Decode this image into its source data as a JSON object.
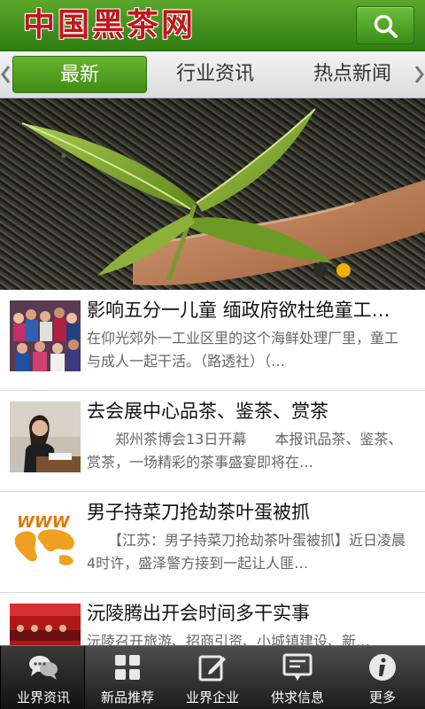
{
  "header": {
    "logo_text": "中国黑茶网",
    "search_icon": "search-icon"
  },
  "tabs": [
    {
      "label": "最新",
      "active": true
    },
    {
      "label": "行业资讯",
      "active": false
    },
    {
      "label": "热点新闻",
      "active": false
    }
  ],
  "banner": {
    "image": "tea-leaves-on-wooden-spoon",
    "slide_count": 2,
    "active_slide": 2
  },
  "news": [
    {
      "title": "影响五分一儿童 缅政府欲杜绝童工…",
      "desc": "在仰光郊外一工业区里的这个海鲜处理厂里，童工与成人一起干活。（路透社）（…"
    },
    {
      "title": "去会展中心品茶、鉴茶、赏茶",
      "desc": "　　郑州茶博会13日开幕　　本报讯品茶、鉴茶、赏茶，一场精彩的茶事盛宴即将在…"
    },
    {
      "title": "男子持菜刀抢劫茶叶蛋被抓",
      "desc": "　　【江苏：男子持菜刀抢劫茶叶蛋被抓】近日凌晨4时许，盛泽警方接到一起让人匪…"
    },
    {
      "title": "沅陵腾出开会时间多干实事",
      "desc": "沅陵召开旅游、招商引资、小城镇建设、新…"
    }
  ],
  "bottom_nav": [
    {
      "label": "业界资讯",
      "icon": "chat-bubbles-icon",
      "active": true
    },
    {
      "label": "新品推荐",
      "icon": "grid-icon",
      "active": false
    },
    {
      "label": "业界企业",
      "icon": "edit-icon",
      "active": false
    },
    {
      "label": "供求信息",
      "icon": "message-board-icon",
      "active": false
    },
    {
      "label": "更多",
      "icon": "info-icon",
      "active": false
    }
  ],
  "colors": {
    "brand_green": "#3f8c15",
    "logo_red": "#c3141b",
    "dot_active": "#f0b000",
    "dot_inactive": "#2b2b2b"
  }
}
